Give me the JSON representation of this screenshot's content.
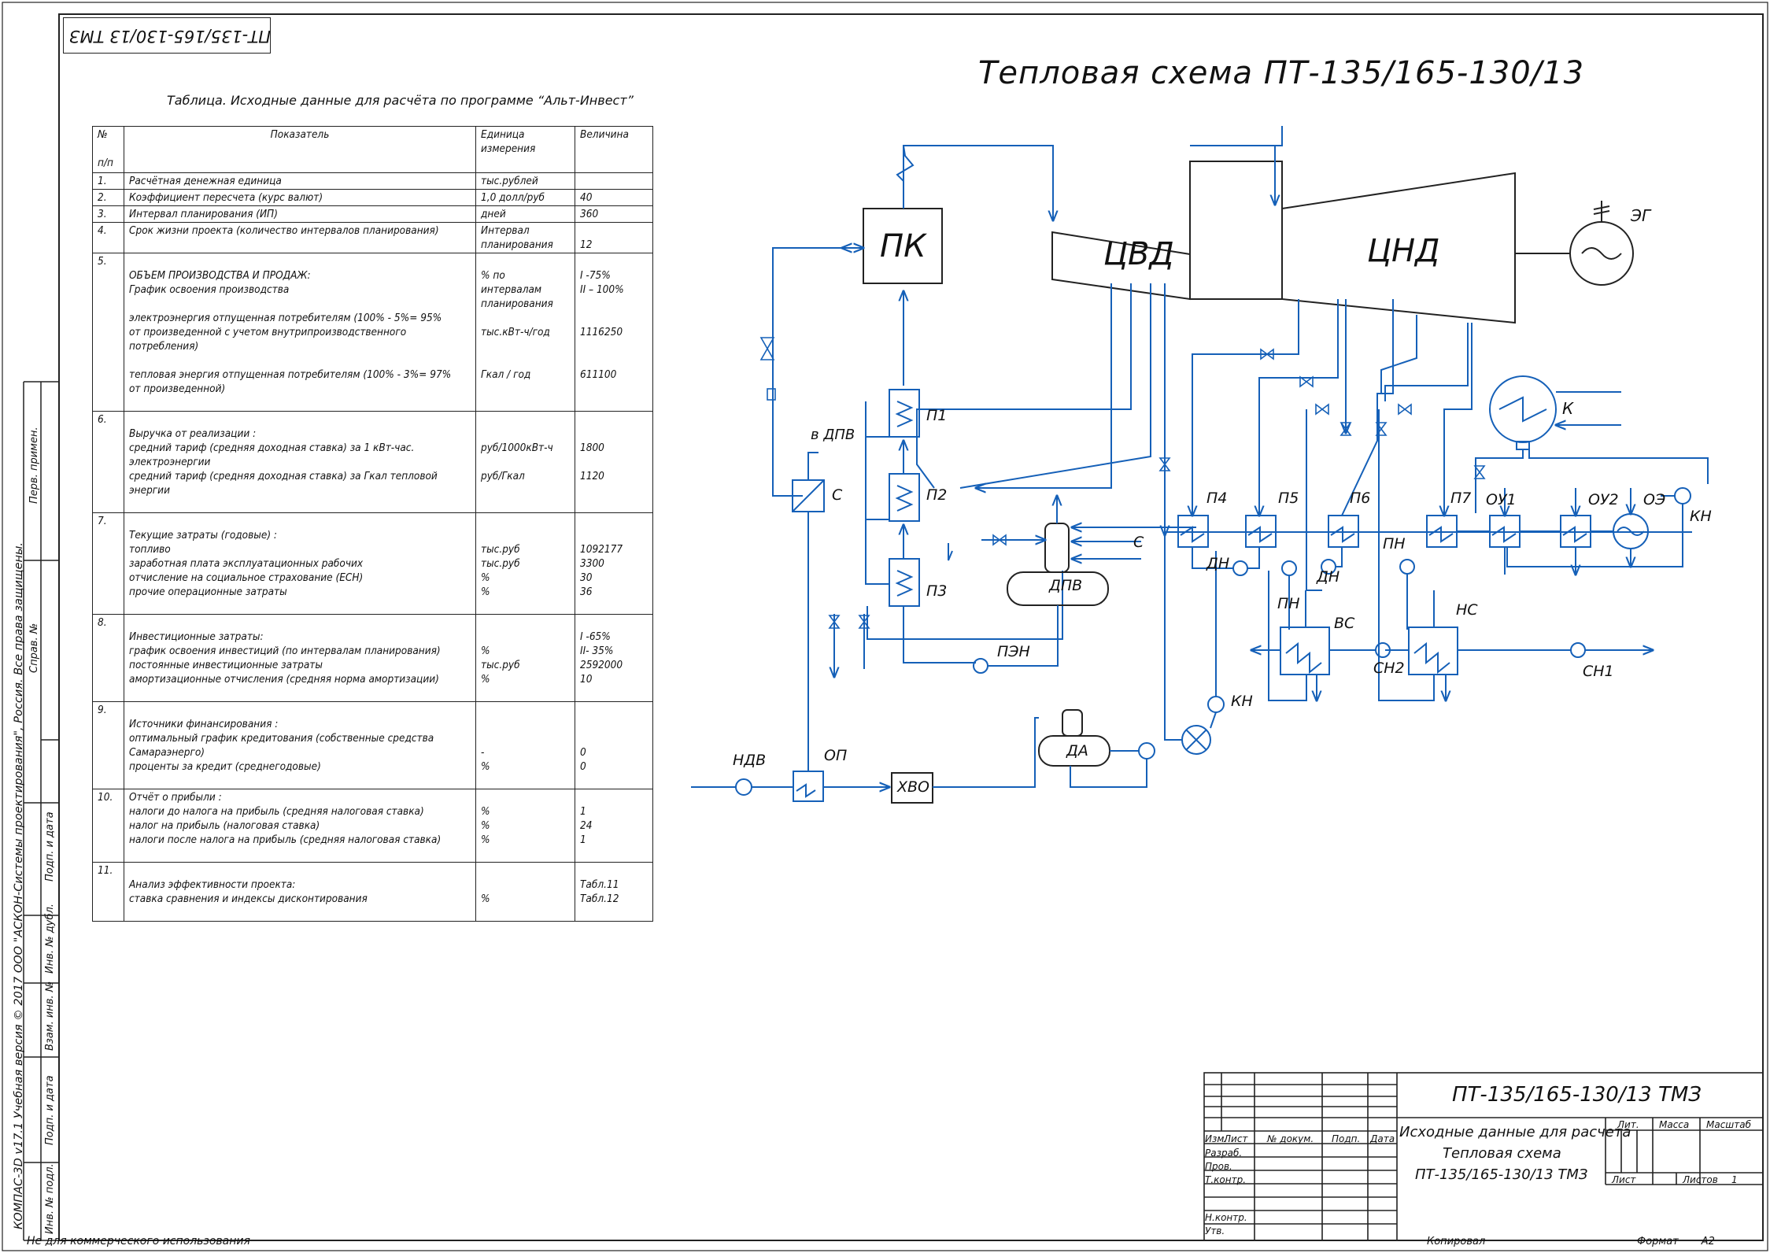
{
  "document_code": "ПТ-135/165-130/13 ТМЗ",
  "scheme_title": "Тепловая схема ПТ-135/165-130/13",
  "table": {
    "title": "Таблица. Исходные данные для расчёта по программе “Альт-Инвест”",
    "headers": {
      "num": "№",
      "num2": "п/п",
      "indicator": "Показатель",
      "unit": "Единица",
      "unit2": "измерения",
      "value": "Величина"
    },
    "rows": [
      {
        "n": "1.",
        "text": [
          "Расчётная денежная единица"
        ],
        "unit": [
          "тыс.рублей"
        ],
        "value": [
          ""
        ]
      },
      {
        "n": "2.",
        "text": [
          "Коэффициент пересчета (курс валют)"
        ],
        "unit": [
          "1,0 долл/руб"
        ],
        "value": [
          "40"
        ]
      },
      {
        "n": "3.",
        "text": [
          "Интервал планирования (ИП)"
        ],
        "unit": [
          "дней"
        ],
        "value": [
          "360"
        ]
      },
      {
        "n": "4.",
        "text": [
          "Срок жизни проекта (количество интервалов планирования)",
          ""
        ],
        "unit": [
          "Интервал",
          "планирования"
        ],
        "value": [
          "",
          "12"
        ]
      },
      {
        "n": "5.",
        "text": [
          "",
          "ОБЪЕМ ПРОИЗВОДСТВА И ПРОДАЖ:",
          "График освоения производства",
          "",
          "электроэнергия отпущенная потребителям (100% - 5%= 95%",
          "от произведенной с учетом внутрипроизводственного",
          "потребления)",
          "",
          "тепловая энергия отпущенная потребителям (100% - 3%= 97%",
          "от произведенной)",
          ""
        ],
        "unit": [
          "",
          "% по",
          "интервалам",
          "планирования",
          "",
          "тыс.кВт-ч/год",
          "",
          "",
          "Гкал / год",
          "",
          ""
        ],
        "value": [
          "",
          "I -75%",
          "II – 100%",
          "",
          "",
          "1116250",
          "",
          "",
          "611100",
          "",
          ""
        ]
      },
      {
        "n": "6.",
        "text": [
          "",
          "Выручка от реализации :",
          "средний тариф (средняя доходная ставка) за 1 кВт-час.",
          "электроэнергии",
          "средний тариф (средняя доходная ставка) за Гкал тепловой",
          "энергии",
          ""
        ],
        "unit": [
          "",
          "",
          "руб/1000кВт-ч",
          "",
          "руб/Гкал",
          "",
          ""
        ],
        "value": [
          "",
          "",
          "1800",
          "",
          "1120",
          "",
          ""
        ]
      },
      {
        "n": "7.",
        "text": [
          "",
          "Текущие затраты (годовые) :",
          "топливо",
          "заработная плата эксплуатационных рабочих",
          "отчисление на социальное страхование (ЕСН)",
          "прочие операционные затраты",
          ""
        ],
        "unit": [
          "",
          "",
          "тыс.руб",
          "тыс.руб",
          "%",
          "%",
          ""
        ],
        "value": [
          "",
          "",
          "1092177",
          "3300",
          "30",
          "36",
          ""
        ]
      },
      {
        "n": "8.",
        "text": [
          "",
          "Инвестиционные затраты:",
          "график освоения инвестиций (по интервалам планирования)",
          "постоянные инвестиционные затраты",
          "амортизационные отчисления (средняя норма амортизации)",
          ""
        ],
        "unit": [
          "",
          "",
          "%",
          "тыс.руб",
          "%",
          ""
        ],
        "value": [
          "",
          "I -65%",
          "II- 35%",
          "2592000",
          "10",
          ""
        ]
      },
      {
        "n": "9.",
        "text": [
          "",
          "Источники финансирования :",
          "оптимальный график кредитования (собственные средства",
          "Самараэнерго)",
          "проценты за кредит (среднегодовые)",
          ""
        ],
        "unit": [
          "",
          "",
          "",
          "-",
          "%",
          ""
        ],
        "value": [
          "",
          "",
          "",
          "0",
          "0",
          ""
        ]
      },
      {
        "n": "10.",
        "text": [
          "Отчёт о прибыли :",
          "налоги до налога на прибыль (средняя налоговая ставка)",
          "налог на прибыль (налоговая ставка)",
          "налоги после налога на прибыль (средняя налоговая ставка)",
          ""
        ],
        "unit": [
          "",
          "%",
          "%",
          "%",
          ""
        ],
        "value": [
          "",
          "1",
          "24",
          "1",
          ""
        ]
      },
      {
        "n": "11.",
        "text": [
          "",
          "Анализ эффективности проекта:",
          "ставка сравнения и индексы дисконтирования",
          ""
        ],
        "unit": [
          "",
          "",
          "%",
          ""
        ],
        "value": [
          "",
          "Табл.11",
          "Табл.12",
          ""
        ]
      }
    ]
  },
  "diagram": {
    "labels": {
      "pk": "ПК",
      "cvd": "ЦВД",
      "cnd": "ЦНД",
      "eg": "ЭГ",
      "k": "К",
      "p1": "П1",
      "p2": "П2",
      "p3": "П3",
      "p4": "П4",
      "p5": "П5",
      "p6": "П6",
      "p7": "П7",
      "ou1": "ОУ1",
      "ou2": "ОУ2",
      "oe": "ОЭ",
      "kn_top": "КН",
      "dpv": "ДПВ",
      "v_dpv": "в ДПВ",
      "s1": "С",
      "s2": "С",
      "pen": "ПЭН",
      "dn1": "ДН",
      "dn2": "ДН",
      "pn1": "ПН",
      "pn2": "ПН",
      "vs": "ВС",
      "ns": "НС",
      "sn2": "СН2",
      "sn1": "СН1",
      "kn": "КН",
      "ndv": "НДВ",
      "op": "ОП",
      "hvo": "ХВО",
      "da": "ДА"
    }
  },
  "title_block": {
    "code": "ПТ-135/165-130/13 ТМЗ",
    "name_lines": [
      "Исходные данные для расчета",
      "Тепловая схема",
      "ПТ-135/165-130/13 ТМЗ"
    ],
    "col_headers": [
      "Изм.",
      "Лист",
      "№ докум.",
      "Подп.",
      "Дата"
    ],
    "roles": [
      "Разраб.",
      "Пров.",
      "Т.контр.",
      "",
      "Н.контр.",
      "Утв."
    ],
    "lit": "Лит.",
    "mass": "Масса",
    "scale": "Масштаб",
    "sheet": "Лист",
    "sheets": "Листов",
    "sheets_value": "1"
  },
  "sidebar": {
    "labels": [
      "Перв. примен.",
      "Справ. №",
      "Подп. и дата",
      "Инв. № дубл.",
      "Взам. инв. №",
      "Подп. и дата",
      "Инв. № подл."
    ],
    "copyright": "КОМПАС-3D v17.1 Учебная версия © 2017 ООО \"АСКОН-Системы проектирования\", Россия. Все права защищены."
  },
  "footer": {
    "note": "Не для коммерческого использования",
    "copier": "Копировал",
    "format": "Формат",
    "format_value": "А2"
  }
}
